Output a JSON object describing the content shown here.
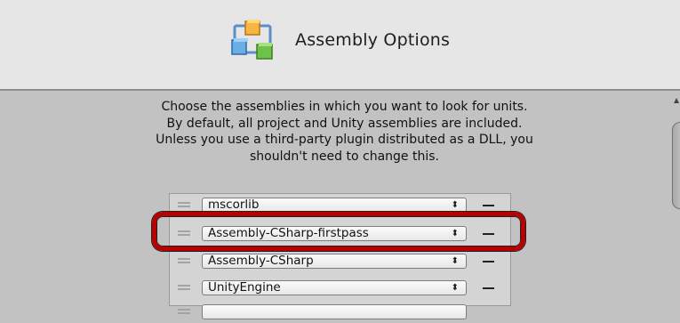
{
  "header": {
    "title": "Assembly Options",
    "icon": "assembly-options-icon"
  },
  "description": [
    "Choose the assemblies in which you want to look for units.",
    "By default, all project and Unity assemblies are included.",
    "Unless you use a third-party plugin distributed as a DLL, you",
    "shouldn't need to change this."
  ],
  "assemblies": [
    {
      "name": "mscorlib"
    },
    {
      "name": "Assembly-CSharp-firstpass"
    },
    {
      "name": "Assembly-CSharp"
    },
    {
      "name": "UnityEngine"
    },
    {
      "name": ""
    }
  ],
  "controls": {
    "popup_arrow": "⬍",
    "remove_symbol": "−"
  },
  "colors": {
    "highlight": "#b80000",
    "header_bg": "#e6e6e6",
    "body_bg": "#c2c2c2"
  }
}
